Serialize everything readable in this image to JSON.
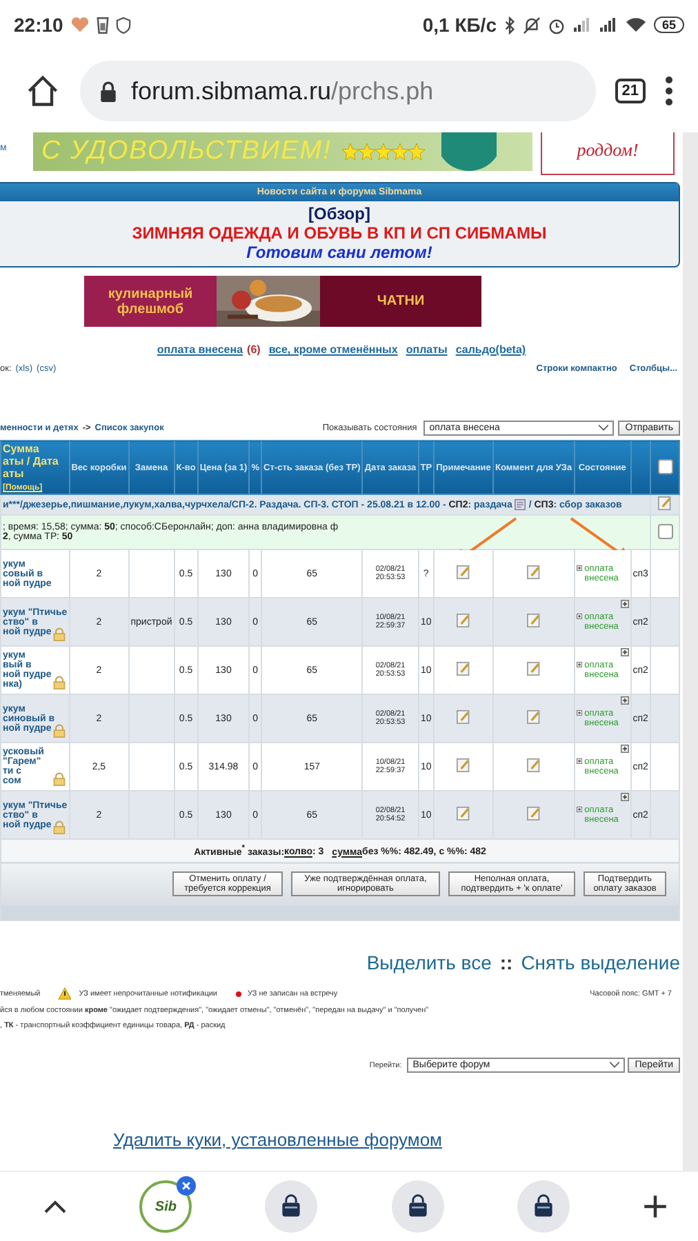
{
  "status_bar": {
    "time": "22:10",
    "speed": "0,1 КБ/с",
    "battery": "65"
  },
  "browser": {
    "url_domain": "forum.sibmama.ru",
    "url_path": "/prchs.ph",
    "tab_count": "21"
  },
  "top_banner": {
    "left_text": "м",
    "slogan": "С УДОВОЛЬСТВИЕМ!",
    "side_text": "роддом!"
  },
  "news": {
    "title": "Новости сайта и форума Sibmama",
    "link": "[Обзор]",
    "headline": "ЗИМНЯЯ ОДЕЖДА И ОБУВЬ В КП И СП СИБМАМЫ",
    "tagline": "Готовим сани летом!"
  },
  "promo": {
    "left_text": "кулинарный флешмоб",
    "right_text": "ЧАТНИ"
  },
  "filters": [
    {
      "label": "оплата внесена",
      "count": "(6)"
    },
    {
      "label": "все, кроме отменённых"
    },
    {
      "label": "оплаты"
    },
    {
      "label": "сальдо(beta)"
    }
  ],
  "export": {
    "prefix": "ок:",
    "links": [
      "(xls)",
      "(csv)"
    ]
  },
  "view_links": [
    "Строки компактно",
    "Столбцы..."
  ],
  "breadcrumb": {
    "parent": "менности и детях",
    "separator": "->",
    "current": "Список закупок"
  },
  "state_filter": {
    "label": "Показывать состояния",
    "value": "оплата внесена",
    "button": "Отправить"
  },
  "table": {
    "columns": [
      {
        "lines": [
          "Сумма",
          "аты / Дата",
          "аты"
        ],
        "help": "[Помощь]"
      },
      {
        "label": "Вес коробки"
      },
      {
        "label": "Замена"
      },
      {
        "label": "К-во"
      },
      {
        "label": "Цена (за 1)"
      },
      {
        "label": "%"
      },
      {
        "label": "Ст-сть заказа (без ТР)"
      },
      {
        "label": "Дата заказа"
      },
      {
        "label": "ТР"
      },
      {
        "label": "Примечание"
      },
      {
        "label": "Коммент для УЗа"
      },
      {
        "label": "Состояние"
      }
    ],
    "select_all_checked": false,
    "group": {
      "title": "и***/джезерье,пишмание,лукум,халва,чурчхела/СП-2. Раздача. СП-3. СТОП - 25.08.21 в 12.00 -",
      "text": "**СП2**: раздача",
      "tail": "/ **СП3**: сбор заказов"
    },
    "payment": {
      "lines": [
        "; время: 15,58; сумма: **50**; способ:СБеронлайн; доп: анна владимировна ф",
        "**2**, сумма ТР: **50**"
      ],
      "checked": false
    },
    "rows": [
      {
        "name_lines": [
          "укум",
          "совый в",
          "ной пудре"
        ],
        "locked": false,
        "weight": "2",
        "qty": "0.5",
        "price": "130",
        "percent": "0",
        "cost": "65",
        "date": "02/08/21",
        "time": "20:53:53",
        "tr": "?",
        "status": "оплата внесена",
        "extra": false,
        "sp": "сп3"
      },
      {
        "name_lines": [
          "укум \"Птичье",
          "ство\" в",
          "ной пудре"
        ],
        "locked": true,
        "weight": "2",
        "replacement": "пристрой",
        "qty": "0.5",
        "price": "130",
        "percent": "0",
        "cost": "65",
        "date": "10/08/21",
        "time": "22:59:37",
        "tr": "10",
        "status": "оплата внесена",
        "extra": true,
        "sp": "сп2"
      },
      {
        "name_lines": [
          "укум",
          "вый в",
          "ной пудре",
          "нка)"
        ],
        "locked": true,
        "weight": "2",
        "qty": "0.5",
        "price": "130",
        "percent": "0",
        "cost": "65",
        "date": "02/08/21",
        "time": "20:53:53",
        "tr": "10",
        "status": "оплата внесена",
        "extra": true,
        "sp": "сп2"
      },
      {
        "name_lines": [
          "укум",
          "синовый в",
          "ной пудре"
        ],
        "locked": true,
        "weight": "2",
        "qty": "0.5",
        "price": "130",
        "percent": "0",
        "cost": "65",
        "date": "02/08/21",
        "time": "20:53:53",
        "tr": "10",
        "status": "оплата внесена",
        "extra": true,
        "sp": "сп2"
      },
      {
        "name_lines": [
          "усковый",
          "\"Гарем\"",
          "ти с",
          "сом"
        ],
        "locked": true,
        "weight": "2,5",
        "qty": "0.5",
        "price": "314.98",
        "percent": "0",
        "cost": "157",
        "date": "10/08/21",
        "time": "22:59:37",
        "tr": "10",
        "status": "оплата внесена",
        "extra": true,
        "sp": "сп2"
      },
      {
        "name_lines": [
          "укум \"Птичье",
          "ство\" в",
          "ной пудре"
        ],
        "locked": true,
        "weight": "2",
        "qty": "0.5",
        "price": "130",
        "percent": "0",
        "cost": "65",
        "date": "02/08/21",
        "time": "20:54:52",
        "tr": "10",
        "status": "оплата внесена",
        "extra": true,
        "sp": "сп2"
      }
    ],
    "totals": {
      "label": "Активные$^{*}$ заказы:",
      "count_link": "колво",
      "count": ": 3",
      "sum_link": "сумма",
      "rest": "без %%: 482.49,   с %%: 482"
    },
    "buttons": [
      "Отменить оплату / требуется коррекция",
      "Уже подтверждённая оплата, игнорировать",
      "Неполная оплата, подтвердить + 'к оплате'",
      "Подтвердить оплату заказов"
    ]
  },
  "selection": {
    "select_all": "Выделить все",
    "separator": "::",
    "clear": "Снять выделение"
  },
  "legend": [
    {
      "kind": "text",
      "text": "тменяемый"
    },
    {
      "kind": "warning",
      "text": "УЗ имеет непрочитанные нотификации"
    },
    {
      "kind": "dot",
      "text": "УЗ не записан на встречу"
    }
  ],
  "timezone": "Часовой пояс: GMT + 7",
  "notes": [
    "йся в любом состоянии **кроме** \"ожидает подтверждения\", \"ожидает отмены\", \"отменён\", \"передан на выдачу\" и \"получен\"",
    ", **ТК** - транспортный коэффициент единицы товара, **РД** - раскид"
  ],
  "jump": {
    "label": "Перейти:",
    "value": "Выберите форум",
    "button": "Перейти"
  },
  "cookie_link": "Удалить куки, установленные форумом",
  "bottom_tabs": [
    {
      "kind": "logo",
      "label": "Sib",
      "closable": true
    },
    {
      "kind": "bag"
    },
    {
      "kind": "bag"
    },
    {
      "kind": "bag"
    }
  ]
}
